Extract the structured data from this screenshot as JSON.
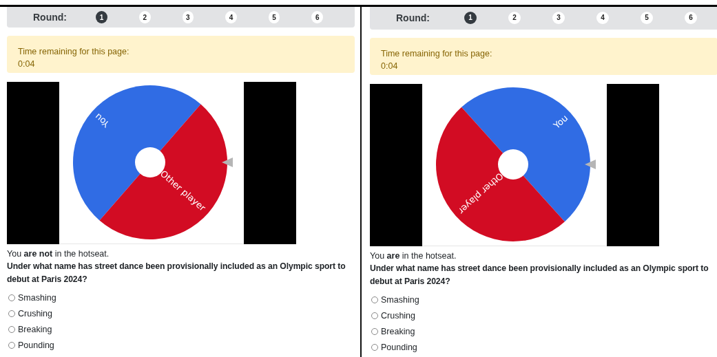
{
  "panels": [
    {
      "round_label": "Round:",
      "rounds": [
        {
          "label": "1",
          "selected": true
        },
        {
          "label": "2",
          "selected": false
        },
        {
          "label": "3",
          "selected": false
        },
        {
          "label": "4",
          "selected": false
        },
        {
          "label": "5",
          "selected": false
        },
        {
          "label": "6",
          "selected": false
        }
      ],
      "timer": {
        "label": "Time remaining for this page:",
        "value": "0:04"
      },
      "wheel": {
        "segments": [
          {
            "label": "You",
            "color": "#306ce4"
          },
          {
            "label": "Other player",
            "color": "#d20c23"
          }
        ]
      },
      "hotseat_text": "You **are not** in the hotseat.",
      "question": "Under what name has street dance been provisionally included as an Olympic sport to debut at Paris 2024?",
      "options": [
        {
          "label": "Smashing",
          "selected": false
        },
        {
          "label": "Crushing",
          "selected": false
        },
        {
          "label": "Breaking",
          "selected": false
        },
        {
          "label": "Pounding",
          "selected": false
        }
      ]
    },
    {
      "round_label": "Round:",
      "rounds": [
        {
          "label": "1",
          "selected": true
        },
        {
          "label": "2",
          "selected": false
        },
        {
          "label": "3",
          "selected": false
        },
        {
          "label": "4",
          "selected": false
        },
        {
          "label": "5",
          "selected": false
        },
        {
          "label": "6",
          "selected": false
        }
      ],
      "timer": {
        "label": "Time remaining for this page:",
        "value": "0:04"
      },
      "wheel": {
        "segments": [
          {
            "label": "You",
            "color": "#306ce4"
          },
          {
            "label": "Other player",
            "color": "#d20c23"
          }
        ]
      },
      "hotseat_text": "You **are** in the hotseat.",
      "question": "Under what name has street dance been provisionally included as an Olympic sport to debut at Paris 2024?",
      "options": [
        {
          "label": "Smashing",
          "selected": false
        },
        {
          "label": "Crushing",
          "selected": false
        },
        {
          "label": "Breaking",
          "selected": false
        },
        {
          "label": "Pounding",
          "selected": false
        }
      ]
    }
  ]
}
